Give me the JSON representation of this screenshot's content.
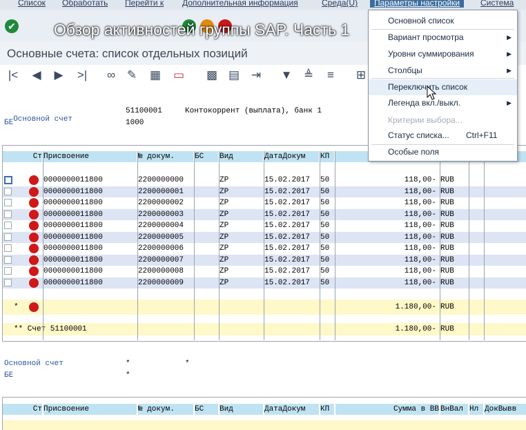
{
  "menubar": [
    "Список",
    "Обработать",
    "Перейти к",
    "Дополнительная информация",
    "Среда(U)",
    "Параметры настройки",
    "Система"
  ],
  "video_title": "Обзор активностей группы SAP. Часть 1",
  "page_title": "Основные счета: список отдельных позиций",
  "block1": {
    "account_label": "Основной счет",
    "account_value": "51100001",
    "account_desc": "Контокоррент (выплата), банк 1",
    "be_label": "БЕ",
    "be_value": "1000"
  },
  "table_headers": [
    "Ст",
    "Присвоение",
    "№ докум.",
    "БС",
    "Вид",
    "ДатаДокум",
    "КП",
    "Сумма в ВВ",
    "ВнВал",
    "Нл",
    "ДокВывв"
  ],
  "rows": [
    {
      "assignment": "0000000011800",
      "doc": "2200000000",
      "type": "ZP",
      "date": "15.02.2017",
      "kp": "50",
      "amount": "118,00-",
      "cur": "RUB"
    },
    {
      "assignment": "0000000011800",
      "doc": "2200000001",
      "type": "ZP",
      "date": "15.02.2017",
      "kp": "50",
      "amount": "118,00-",
      "cur": "RUB"
    },
    {
      "assignment": "0000000011800",
      "doc": "2200000002",
      "type": "ZP",
      "date": "15.02.2017",
      "kp": "50",
      "amount": "118,00-",
      "cur": "RUB"
    },
    {
      "assignment": "0000000011800",
      "doc": "2200000003",
      "type": "ZP",
      "date": "15.02.2017",
      "kp": "50",
      "amount": "118,00-",
      "cur": "RUB"
    },
    {
      "assignment": "0000000011800",
      "doc": "2200000004",
      "type": "ZP",
      "date": "15.02.2017",
      "kp": "50",
      "amount": "118,00-",
      "cur": "RUB"
    },
    {
      "assignment": "0000000011800",
      "doc": "2200000005",
      "type": "ZP",
      "date": "15.02.2017",
      "kp": "50",
      "amount": "118,00-",
      "cur": "RUB"
    },
    {
      "assignment": "0000000011800",
      "doc": "2200000006",
      "type": "ZP",
      "date": "15.02.2017",
      "kp": "50",
      "amount": "118,00-",
      "cur": "RUB"
    },
    {
      "assignment": "0000000011800",
      "doc": "2200000007",
      "type": "ZP",
      "date": "15.02.2017",
      "kp": "50",
      "amount": "118,00-",
      "cur": "RUB"
    },
    {
      "assignment": "0000000011800",
      "doc": "2200000008",
      "type": "ZP",
      "date": "15.02.2017",
      "kp": "50",
      "amount": "118,00-",
      "cur": "RUB"
    },
    {
      "assignment": "0000000011800",
      "doc": "2200000009",
      "type": "ZP",
      "date": "15.02.2017",
      "kp": "50",
      "amount": "118,00-",
      "cur": "RUB"
    }
  ],
  "subtotal": {
    "marker": "*",
    "amount": "1.180,00-",
    "cur": "RUB"
  },
  "total": {
    "label": "** Счет 51100001",
    "amount": "1.180,00-",
    "cur": "RUB"
  },
  "block2": {
    "account_label": "Основной счет",
    "account_value": "*",
    "account_value2": "*",
    "be_label": "БЕ",
    "be_value": "*"
  },
  "menu": [
    {
      "label": "Основной список",
      "arrow": false,
      "disabled": false,
      "shortcut": ""
    },
    {
      "label": "Вариант просмотра",
      "arrow": true,
      "disabled": false,
      "shortcut": ""
    },
    {
      "label": "Уровни суммирования",
      "arrow": true,
      "disabled": false,
      "shortcut": ""
    },
    {
      "label": "Столбцы",
      "arrow": true,
      "disabled": false,
      "shortcut": ""
    },
    {
      "label": "Переключить список",
      "arrow": false,
      "disabled": false,
      "shortcut": ""
    },
    {
      "label": "Легенда вкл./выкл.",
      "arrow": true,
      "disabled": false,
      "shortcut": ""
    },
    {
      "label": "Критерии выбора...",
      "arrow": false,
      "disabled": true,
      "shortcut": ""
    },
    {
      "label": "Статус списка...",
      "arrow": false,
      "disabled": false,
      "shortcut": "Ctrl+F11"
    },
    {
      "label": "Особые поля",
      "arrow": false,
      "disabled": false,
      "shortcut": ""
    }
  ],
  "colors": {
    "header_blue": "#bfe3f2",
    "row_alt": "#dde4f4",
    "total_yellow": "#fff8c8",
    "status_red": "#d01818"
  }
}
